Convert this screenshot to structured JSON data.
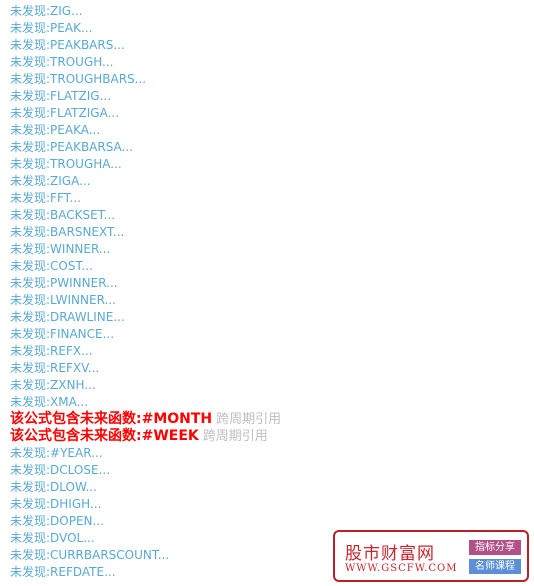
{
  "lines": [
    {
      "text": "未发现:ZIG..."
    },
    {
      "text": "未发现:PEAK..."
    },
    {
      "text": "未发现:PEAKBARS..."
    },
    {
      "text": "未发现:TROUGH..."
    },
    {
      "text": "未发现:TROUGHBARS..."
    },
    {
      "text": "未发现:FLATZIG..."
    },
    {
      "text": "未发现:FLATZIGA..."
    },
    {
      "text": "未发现:PEAKA..."
    },
    {
      "text": "未发现:PEAKBARSA..."
    },
    {
      "text": "未发现:TROUGHA..."
    },
    {
      "text": "未发现:ZIGA..."
    },
    {
      "text": "未发现:FFT..."
    },
    {
      "text": "未发现:BACKSET..."
    },
    {
      "text": "未发现:BARSNEXT..."
    },
    {
      "text": "未发现:WINNER..."
    },
    {
      "text": "未发现:COST..."
    },
    {
      "text": "未发现:PWINNER..."
    },
    {
      "text": "未发现:LWINNER..."
    },
    {
      "text": "未发现:DRAWLINE..."
    },
    {
      "text": "未发现:FINANCE..."
    },
    {
      "text": "未发现:REFX..."
    },
    {
      "text": "未发现:REFXV..."
    },
    {
      "text": "未发现:ZXNH..."
    },
    {
      "text": "未发现:XMA..."
    },
    {
      "text": "该公式包含未来函数:#MONTH",
      "note": "跨周期引用",
      "warning": true
    },
    {
      "text": "该公式包含未来函数:#WEEK",
      "note": "跨周期引用",
      "warning": true
    },
    {
      "text": "未发现:#YEAR..."
    },
    {
      "text": "未发现:DCLOSE..."
    },
    {
      "text": "未发现:DLOW..."
    },
    {
      "text": "未发现:DHIGH..."
    },
    {
      "text": "未发现:DOPEN..."
    },
    {
      "text": "未发现:DVOL..."
    },
    {
      "text": "未发现:CURRBARSCOUNT..."
    },
    {
      "text": "未发现:REFDATE..."
    }
  ],
  "colors": {
    "not_found_text": "#5aa9d3",
    "warning_text": "#ff0000",
    "note_text": "#bfbfbf"
  },
  "watermark": {
    "name": "股市财富网",
    "url": "WWW.GSCFW.COM",
    "tag1": "指标分享",
    "tag2": "名师课程"
  }
}
